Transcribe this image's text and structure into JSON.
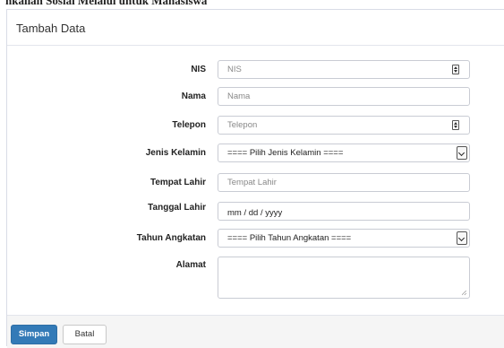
{
  "top_strip": {
    "text": "nkalian Sosial Melalui untuk Mahasiswa"
  },
  "panel": {
    "title": "Tambah Data"
  },
  "form": {
    "nis": {
      "label": "NIS",
      "placeholder": "NIS"
    },
    "nama": {
      "label": "Nama",
      "placeholder": "Nama"
    },
    "telepon": {
      "label": "Telepon",
      "placeholder": "Telepon"
    },
    "jenis_kelamin": {
      "label": "Jenis Kelamin",
      "selected": "==== Pilih Jenis Kelamin ===="
    },
    "tempat_lahir": {
      "label": "Tempat Lahir",
      "placeholder": "Tempat Lahir"
    },
    "tanggal_lahir": {
      "label": "Tanggal Lahir",
      "value": "mm / dd / yyyy"
    },
    "tahun_angkatan": {
      "label": "Tahun Angkatan",
      "selected": "==== Pilih Tahun Angkatan ===="
    },
    "alamat": {
      "label": "Alamat",
      "value": ""
    }
  },
  "footer": {
    "save_label": "Simpan",
    "cancel_label": "Batal"
  },
  "colors": {
    "primary": "#337ab7",
    "border": "#c9ccd4",
    "footer_bg": "#f5f5f5"
  },
  "icons": {
    "spinner": "number-spinner-icon",
    "select": "chevron-down-icon",
    "resize": "resize-grip-icon"
  }
}
